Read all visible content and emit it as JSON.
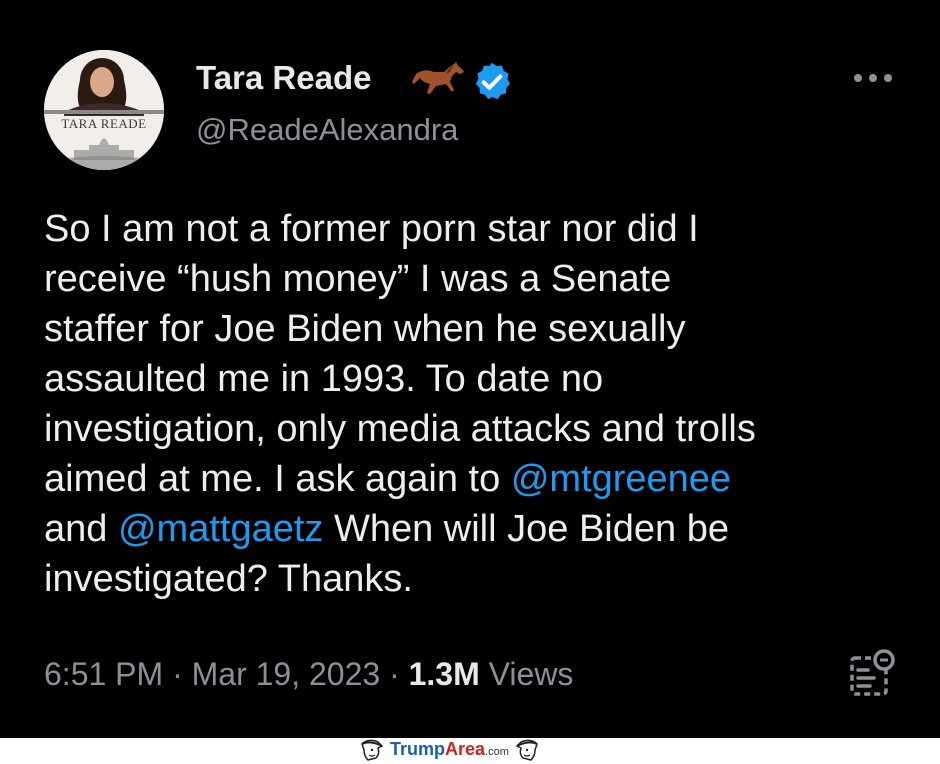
{
  "tweet": {
    "author": {
      "display_name": "Tara Reade",
      "handle": "@ReadeAlexandra",
      "avatar_caption": "TARA READE",
      "name_emoji_icon": "horse-icon",
      "verified_icon": "verified-badge-icon"
    },
    "text_parts": {
      "p1": "So I am not a former porn star nor did I\nreceive “hush money” I was a Senate\nstaffer for Joe Biden when he sexually\nassaulted me in 1993. To date no\ninvestigation, only media attacks and trolls\naimed at me. I ask again to ",
      "mention1": "@mtgreenee",
      "p2": "\nand ",
      "mention2": "@mattgaetz",
      "p3": " When will Joe Biden be\ninvestigated? Thanks."
    },
    "meta": {
      "time": "6:51 PM",
      "sep1": " · ",
      "date": "Mar 19, 2023",
      "sep2": " · ",
      "views_count": "1.3M",
      "views_label": " Views"
    }
  },
  "footer": {
    "brand_a": "Trump",
    "brand_b": "Area",
    "brand_c": ".com"
  },
  "colors": {
    "background": "#000000",
    "text": "#e7e9ea",
    "secondary": "#8b9197",
    "link": "#1d9bf0",
    "verified": "#1d9bf0"
  }
}
